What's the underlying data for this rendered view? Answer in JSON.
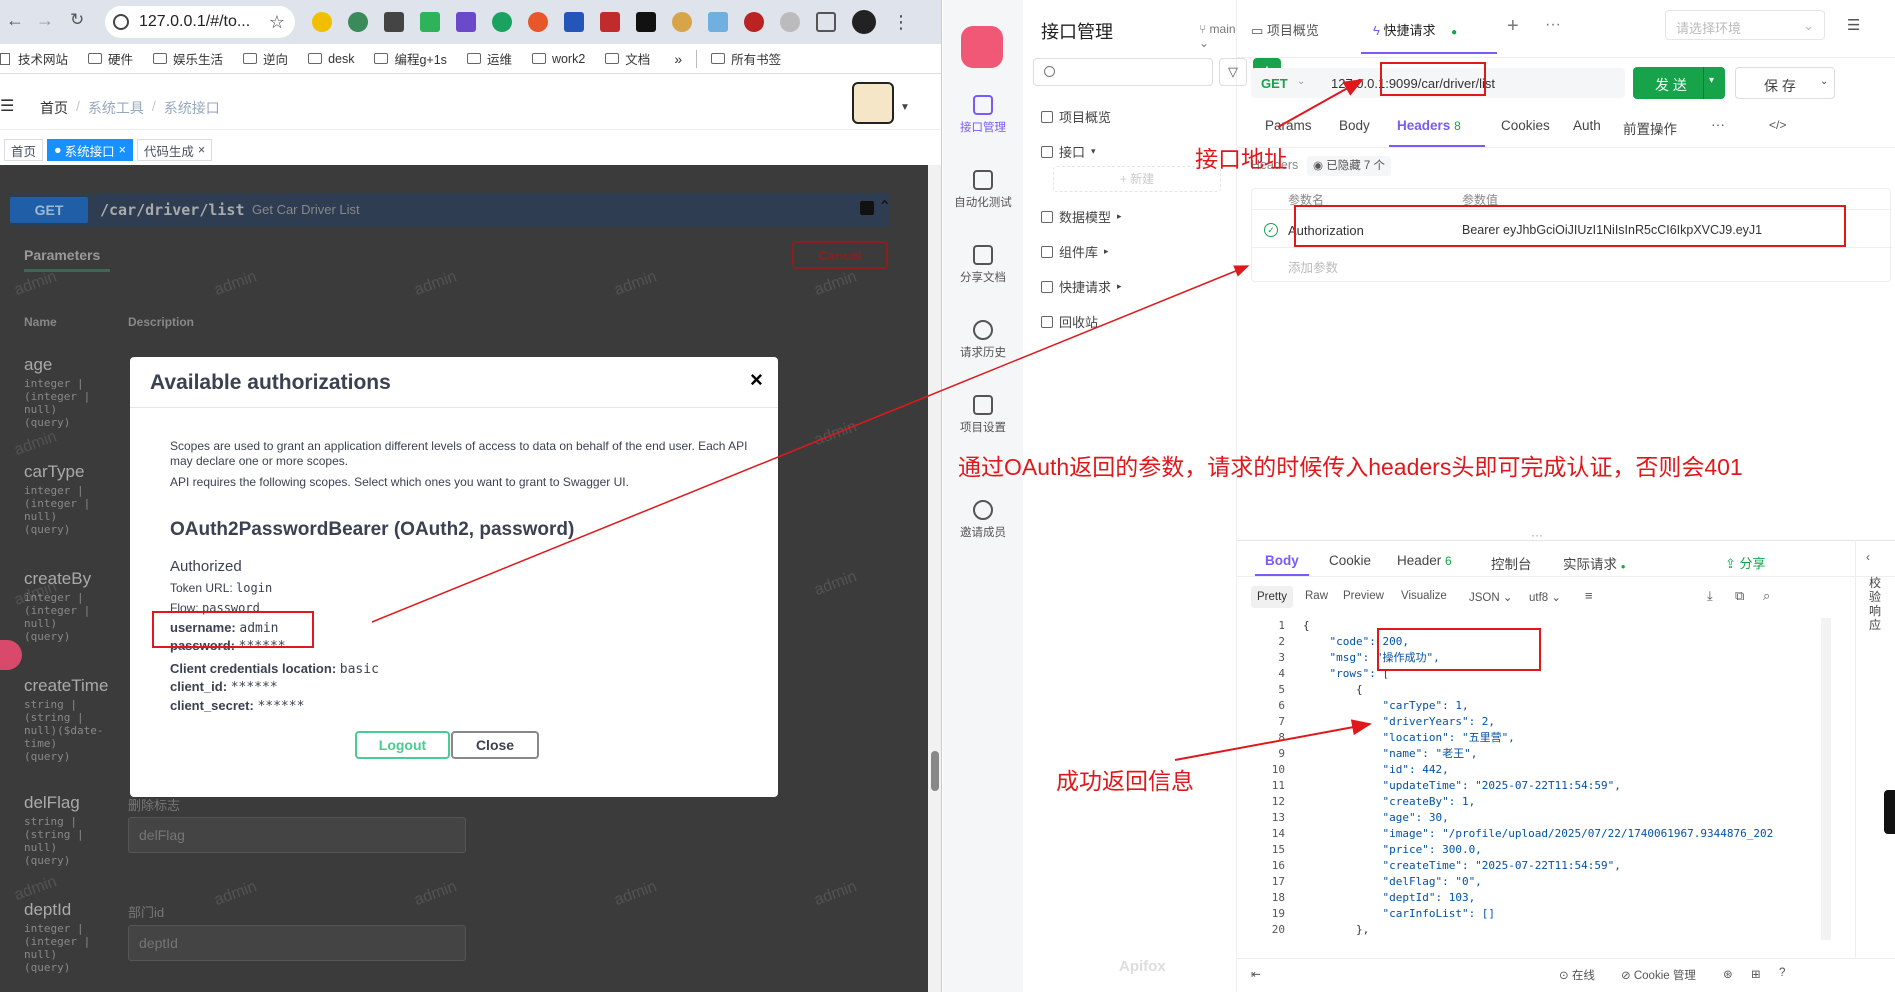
{
  "browser": {
    "url": "127.0.0.1/#/to...",
    "bookmarks": [
      "技术网站",
      "硬件",
      "娱乐生活",
      "逆向",
      "desk",
      "编程g+1s",
      "运维",
      "work2",
      "文档"
    ],
    "all_bookmarks": "所有书签"
  },
  "admin": {
    "breadcrumb": [
      "首页",
      "系统工具",
      "系统接口"
    ],
    "tags": [
      "首页",
      "系统接口",
      "代码生成"
    ],
    "watermark": "admin"
  },
  "swagger": {
    "method": "GET",
    "path": "/car/driver/list",
    "summary": "Get Car Driver List",
    "parameters_tab": "Parameters",
    "cancel": "Cancel",
    "col_name": "Name",
    "col_desc": "Description",
    "params": [
      {
        "name": "age",
        "type": "integer |\n(integer |\nnull)\n(query)"
      },
      {
        "name": "carType",
        "type": "integer |\n(integer |\nnull)\n(query)"
      },
      {
        "name": "createBy",
        "type": "integer |\n(integer |\nnull)\n(query)"
      },
      {
        "name": "createTime",
        "type": "string |\n(string |\nnull)($date-\ntime)\n(query)"
      },
      {
        "name": "delFlag",
        "type": "string |\n(string |\nnull)\n(query)",
        "desc": "删除标志",
        "placeholder": "delFlag"
      },
      {
        "name": "deptId",
        "type": "integer |\n(integer |\nnull)\n(query)",
        "desc": "部门id",
        "placeholder": "deptId"
      }
    ]
  },
  "modal": {
    "title": "Available authorizations",
    "close_x": "×",
    "desc1": "Scopes are used to grant an application different levels of access to data on behalf of the end user. Each API may declare one or more scopes.",
    "desc2": "API requires the following scopes. Select which ones you want to grant to Swagger UI.",
    "scheme": "OAuth2PasswordBearer (OAuth2, password)",
    "authorized": "Authorized",
    "token_url_label": "Token URL:",
    "token_url": "login",
    "flow_label": "Flow:",
    "flow": "password",
    "username_label": "username:",
    "username": "admin",
    "password_label": "password:",
    "password": "******",
    "client_loc_label": "Client credentials location:",
    "client_loc": "basic",
    "client_id_label": "client_id:",
    "client_id": "******",
    "client_secret_label": "client_secret:",
    "client_secret": "******",
    "logout": "Logout",
    "close": "Close"
  },
  "apifox": {
    "nav": [
      "接口管理",
      "自动化测试",
      "分享文档",
      "请求历史",
      "项目设置",
      "邀请成员"
    ],
    "tree_title": "接口管理",
    "branch": "main",
    "tree": [
      "项目概览",
      "接口",
      "+ 新建",
      "数据模型",
      "组件库",
      "快捷请求",
      "回收站"
    ],
    "tabs": [
      "项目概览",
      "快捷请求"
    ],
    "env_placeholder": "请选择环境",
    "method": "GET",
    "url_host": "127.0.0.1:9099",
    "url_path": "/car/driver/list",
    "send": "发 送",
    "save": "保 存",
    "req_tabs": [
      "Params",
      "Body",
      "Headers",
      "Cookies",
      "Auth",
      "前置操作"
    ],
    "headers_count": "8",
    "headers_label": "Headers",
    "hidden": "已隐藏 7 个",
    "col_param": "参数名",
    "col_value": "参数值",
    "header_key": "Authorization",
    "header_value": "Bearer eyJhbGciOiJIUzI1NiIsInR5cCI6IkpXVCJ9.eyJ1",
    "add_param": "添加参数",
    "resp_tabs": [
      "Body",
      "Cookie",
      "Header",
      "控制台",
      "实际请求"
    ],
    "resp_header_count": "6",
    "share": "分享",
    "view_tabs": [
      "Pretty",
      "Raw",
      "Preview",
      "Visualize",
      "JSON",
      "utf8"
    ],
    "side_label": "校验响应",
    "footer": [
      "在线",
      "Cookie 管理"
    ],
    "logo": "Apifox"
  },
  "response_lines": [
    "{",
    "    \"code\": 200,",
    "    \"msg\": \"操作成功\",",
    "    \"rows\": [",
    "        {",
    "            \"carType\": 1,",
    "            \"driverYears\": 2,",
    "            \"location\": \"五里营\",",
    "            \"name\": \"老王\",",
    "            \"id\": 442,",
    "            \"updateTime\": \"2025-07-22T11:54:59\",",
    "            \"createBy\": 1,",
    "            \"age\": 30,",
    "            \"image\": \"/profile/upload/2025/07/22/1740061967.9344876_202",
    "            \"price\": 300.0,",
    "            \"createTime\": \"2025-07-22T11:54:59\",",
    "            \"delFlag\": \"0\",",
    "            \"deptId\": 103,",
    "            \"carInfoList\": []",
    "        },"
  ],
  "annotations": {
    "url": "接口地址",
    "oauth": "通过OAuth返回的参数，请求的时候传入headers头即可完成认证，否则会401",
    "success": "成功返回信息"
  }
}
